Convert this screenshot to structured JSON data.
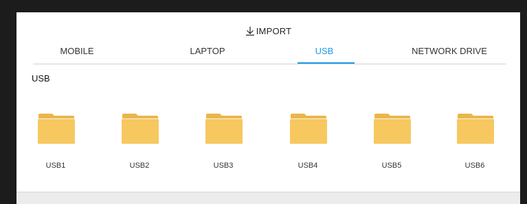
{
  "dialog": {
    "title": "IMPORT",
    "title_icon": "download-arrow-icon"
  },
  "tabs": [
    {
      "label": "MOBILE",
      "active": false
    },
    {
      "label": "LAPTOP",
      "active": false
    },
    {
      "label": "USB",
      "active": true
    },
    {
      "label": "NETWORK DRIVE",
      "active": false
    }
  ],
  "colors": {
    "accent": "#1e9be8",
    "folder_body": "#f6c85f",
    "folder_tab": "#eab64c"
  },
  "section": {
    "title": "USB"
  },
  "folders": [
    {
      "label": "USB1",
      "icon": "folder-icon"
    },
    {
      "label": "USB2",
      "icon": "folder-icon"
    },
    {
      "label": "USB3",
      "icon": "folder-icon"
    },
    {
      "label": "USB4",
      "icon": "folder-icon"
    },
    {
      "label": "USB5",
      "icon": "folder-icon"
    },
    {
      "label": "USB6",
      "icon": "folder-icon"
    }
  ]
}
